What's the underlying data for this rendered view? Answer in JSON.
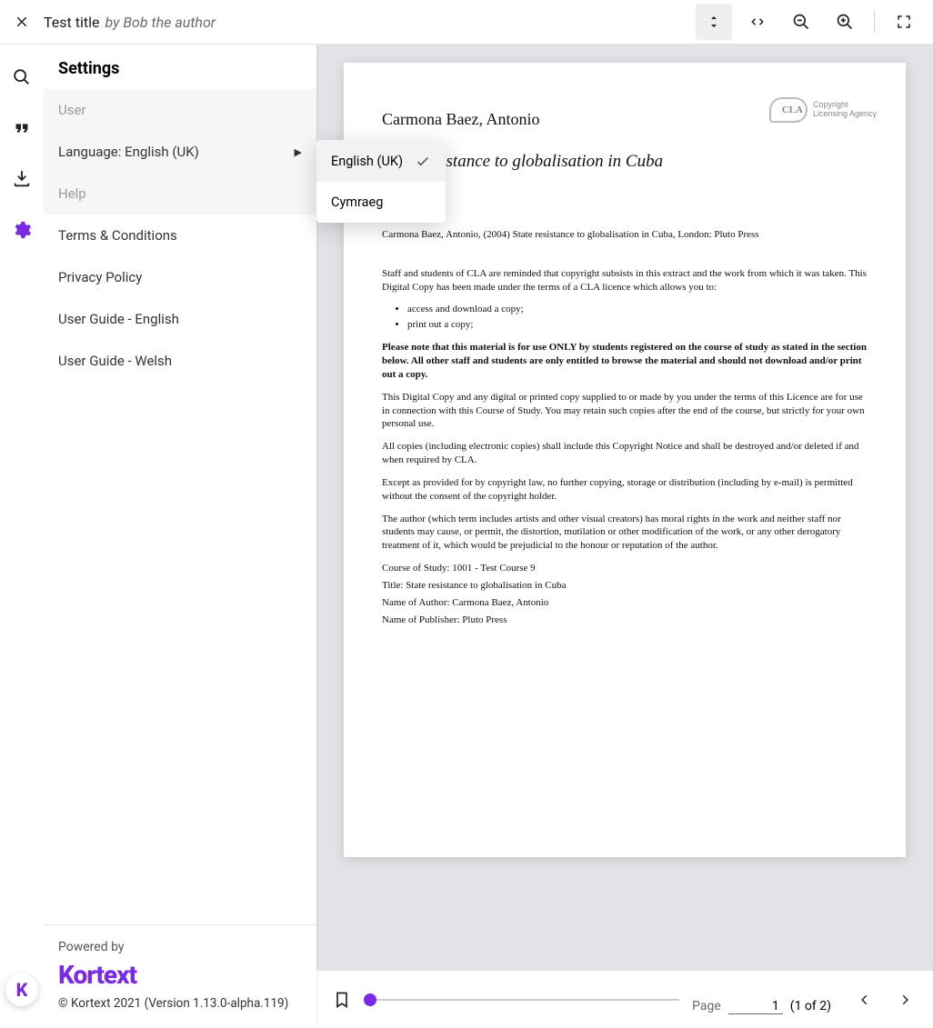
{
  "header": {
    "title": "Test title",
    "by_prefix": "by",
    "author": "Bob the author"
  },
  "sidebar": {
    "heading": "Settings",
    "items": [
      {
        "label": "User",
        "kind": "disabled"
      },
      {
        "label": "Language: English (UK)",
        "kind": "submenu"
      },
      {
        "label": "Help",
        "kind": "disabled"
      },
      {
        "label": "Terms & Conditions",
        "kind": "link"
      },
      {
        "label": "Privacy Policy",
        "kind": "link"
      },
      {
        "label": "User Guide - English",
        "kind": "link"
      },
      {
        "label": "User Guide - Welsh",
        "kind": "link"
      }
    ],
    "language_options": [
      {
        "label": "English (UK)",
        "selected": true
      },
      {
        "label": "Cymraeg",
        "selected": false
      }
    ],
    "footer": {
      "powered": "Powered by",
      "brand": "Kortext",
      "copyright": "© Kortext 2021 (Version 1.13.0-alpha.119)"
    }
  },
  "document": {
    "author_line": "Carmona Baez, Antonio",
    "title_line": "State resistance to globalisation in Cuba",
    "citation": "Carmona Baez, Antonio, (2004) State resistance to globalisation in Cuba, London: Pluto Press",
    "para_intro": "Staff and students of CLA are reminded that copyright subsists in this extract and the work from which it was taken. This Digital Copy has been made under the terms of a CLA licence which allows you to:",
    "bullets": [
      "access and download a copy;",
      "print out a copy;"
    ],
    "notice_bold": "Please note that this material is for use ONLY by students registered on the course of study as stated in the section below. All other staff and students are only entitled to browse the material and should not download and/or print out a copy.",
    "para_a": "This Digital Copy and any digital or printed copy supplied to or made by you under the terms of this Licence are for use in connection with this Course of Study. You may retain such copies after the end of the course, but strictly for your own personal use.",
    "para_b": "All copies (including electronic copies) shall include this Copyright Notice and shall be destroyed and/or deleted if and when required by CLA.",
    "para_c": "Except as provided for by copyright law, no further copying, storage or distribution (including by e-mail) is permitted without the consent of the copyright holder.",
    "para_d": "The author (which term includes artists and other visual creators) has moral rights in the work and neither staff nor students may cause, or permit, the distortion, mutilation or other modification of the work, or any other derogatory treatment of it, which would be prejudicial to the honour or reputation of the author.",
    "meta": {
      "course": "Course of Study: 1001 - Test Course 9",
      "title": "Title: State resistance to globalisation in Cuba",
      "author": "Name of Author: Carmona Baez, Antonio",
      "publisher": "Name of Publisher: Pluto Press"
    },
    "logo": {
      "mark": "CLA",
      "line1": "Copyright",
      "line2": "Licensing Agency"
    }
  },
  "pager": {
    "label": "Page",
    "current": "1",
    "of_text": "(1 of 2)"
  }
}
